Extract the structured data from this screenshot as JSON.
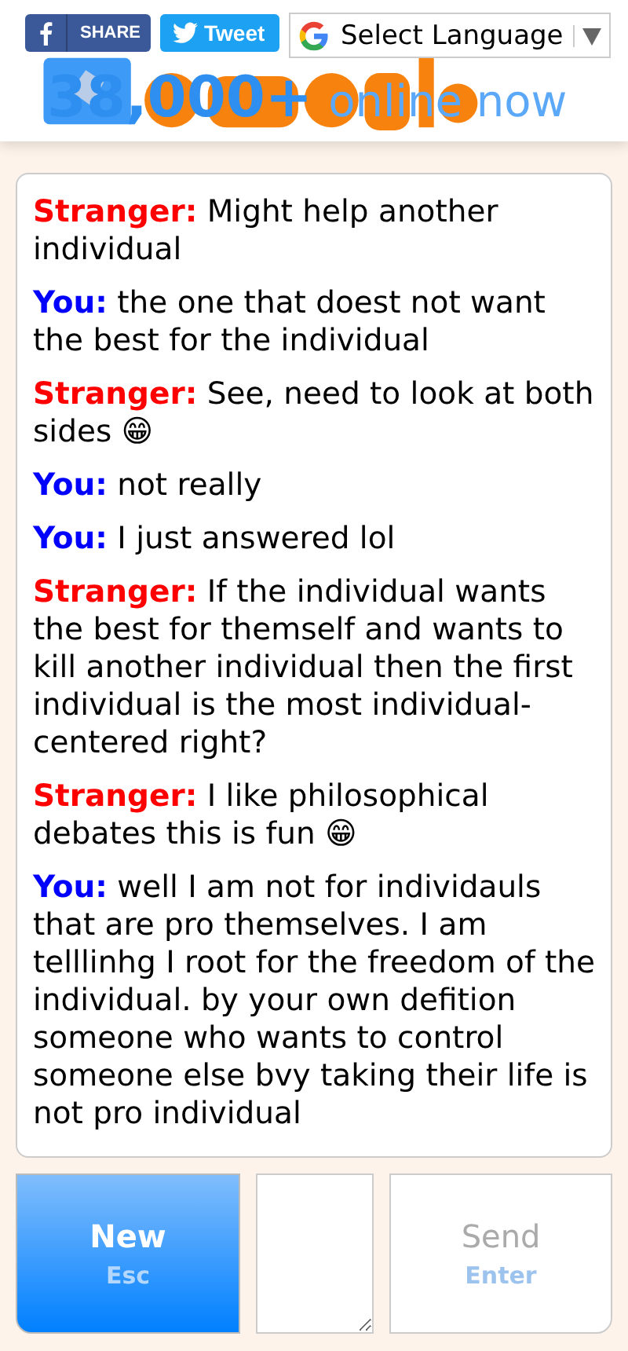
{
  "header": {
    "share_label": "SHARE",
    "tweet_label": "Tweet",
    "language": "Select Language",
    "online_count": "38,000+",
    "online_label": "online now"
  },
  "messages": [
    {
      "kind": "stranger",
      "speaker": "Stranger:",
      "text": "Might help another individual"
    },
    {
      "kind": "you",
      "speaker": "You:",
      "text": "the one that doest not want the best for the individual"
    },
    {
      "kind": "stranger",
      "speaker": "Stranger:",
      "text": "See, need to look at both sides 😁"
    },
    {
      "kind": "you",
      "speaker": "You:",
      "text": "not really"
    },
    {
      "kind": "you",
      "speaker": "You:",
      "text": "I just answered lol"
    },
    {
      "kind": "stranger",
      "speaker": "Stranger:",
      "text": "If the individual wants the best for themself and wants to kill another individual then the first individual is the most individual-centered right?"
    },
    {
      "kind": "stranger",
      "speaker": "Stranger:",
      "text": "I like philosophical debates this is fun 😁"
    },
    {
      "kind": "you",
      "speaker": "You:",
      "text": "well I am not for individauls that are pro themselves. I am telllinhg I root for the freedom of the individual. by your own defition someone who wants to control someone else bvy taking their life is not pro individual"
    }
  ],
  "controls": {
    "new_label": "New",
    "new_key": "Esc",
    "send_label": "Send",
    "send_key": "Enter",
    "send_disabled": true
  }
}
